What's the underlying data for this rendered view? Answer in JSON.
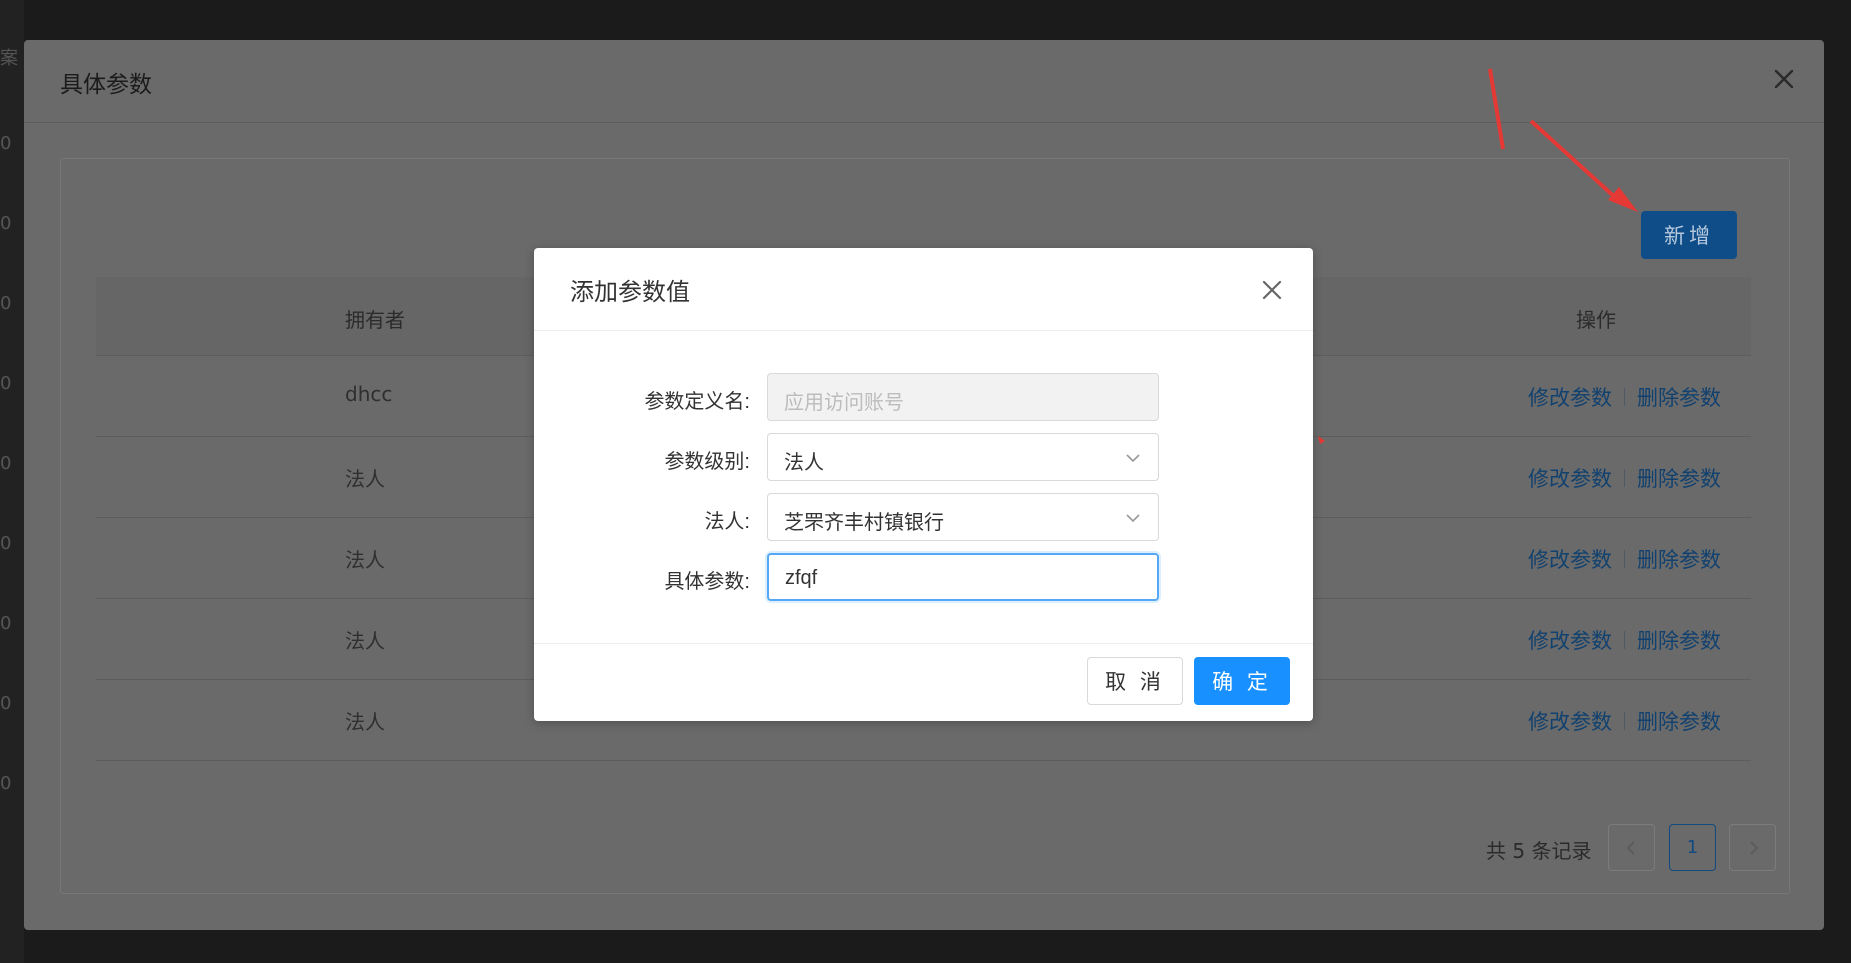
{
  "colors": {
    "primary": "#1890ff",
    "annotation": "#e53935",
    "overlay": "#6a6a6a",
    "link": "#11416f"
  },
  "left_edge": {
    "glyphs": [
      "案",
      "0",
      "0",
      "0",
      "0",
      "0",
      "0",
      "0",
      "0",
      "0"
    ]
  },
  "outer_modal": {
    "title": "具体参数",
    "close_icon": "close-icon",
    "add_button": "新增",
    "table": {
      "columns": [
        "拥有者",
        "操作"
      ],
      "rows": [
        {
          "owner": "dhcc"
        },
        {
          "owner": "法人"
        },
        {
          "owner": "法人"
        },
        {
          "owner": "法人"
        },
        {
          "owner": "法人"
        }
      ],
      "action_edit": "修改参数",
      "action_delete": "删除参数"
    },
    "pagination": {
      "total": "共 5 条记录",
      "current_page": "1",
      "prev_icon": "chevron-left-icon",
      "next_icon": "chevron-right-icon"
    }
  },
  "dialog": {
    "title": "添加参数值",
    "close_icon": "close-icon",
    "fields": {
      "definition_name": {
        "label": "参数定义名:",
        "placeholder": "应用访问账号"
      },
      "level": {
        "label": "参数级别:",
        "value": "法人"
      },
      "legal_entity": {
        "label": "法人:",
        "value": "芝罘齐丰村镇银行"
      },
      "specific_param": {
        "label": "具体参数:",
        "value": "zfqf"
      }
    },
    "cancel_label": "取 消",
    "ok_label": "确 定"
  }
}
